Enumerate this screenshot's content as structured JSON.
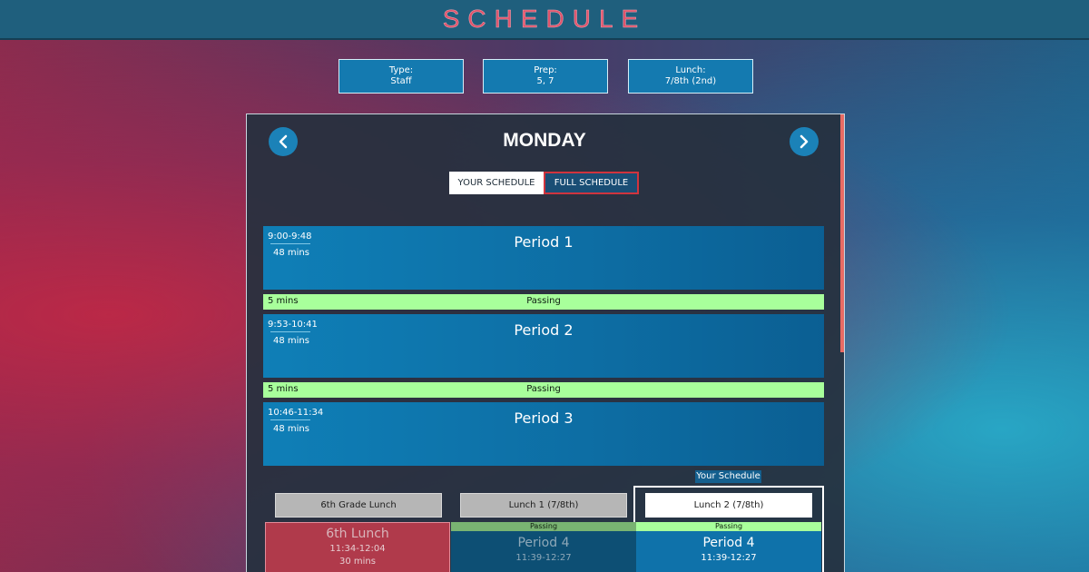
{
  "header": {
    "title": "SCHEDULE"
  },
  "info": [
    {
      "label": "Type:",
      "value": "Staff"
    },
    {
      "label": "Prep:",
      "value": "5, 7"
    },
    {
      "label": "Lunch:",
      "value": "7/8th (2nd)"
    }
  ],
  "day": "MONDAY",
  "toggles": {
    "your": "YOUR SCHEDULE",
    "full": "FULL SCHEDULE"
  },
  "periods": [
    {
      "time": "9:00-9:48",
      "mins": "48 mins",
      "name": "Period 1"
    },
    {
      "time": "9:53-10:41",
      "mins": "48 mins",
      "name": "Period 2"
    },
    {
      "time": "10:46-11:34",
      "mins": "48 mins",
      "name": "Period 3"
    }
  ],
  "passing": [
    {
      "mins": "5 mins",
      "label": "Passing"
    },
    {
      "mins": "5 mins",
      "label": "Passing"
    }
  ],
  "your_schedule_badge": "Your Schedule",
  "lunch_tabs": [
    "6th Grade Lunch",
    "Lunch 1 (7/8th)",
    "Lunch 2 (7/8th)"
  ],
  "lunch_columns": {
    "sixth": {
      "name": "6th Lunch",
      "time": "11:34-12:04",
      "mins": "30 mins"
    },
    "lunch1": {
      "passing": "Passing",
      "name": "Period 4",
      "time": "11:39-12:27"
    },
    "lunch2": {
      "passing": "Passing",
      "name": "Period 4",
      "time": "11:39-12:27"
    }
  },
  "colors": {
    "accent_blue": "#147ab0",
    "passing_green": "#a8ff9b",
    "title_red": "#e0526a",
    "lunch_red": "#b03a4b"
  },
  "icons": {
    "prev": "chevron-left-icon",
    "next": "chevron-right-icon"
  }
}
